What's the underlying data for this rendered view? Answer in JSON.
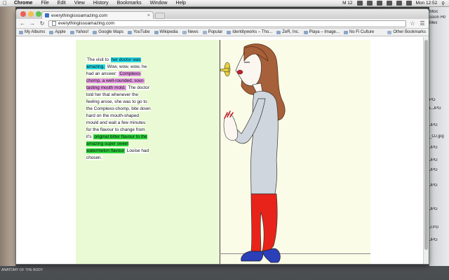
{
  "menubar": {
    "app": "Chrome",
    "items": [
      "File",
      "Edit",
      "View",
      "History",
      "Bookmarks",
      "Window",
      "Help"
    ],
    "status_m": "M 12",
    "clock": "Mon 12:52"
  },
  "browser": {
    "tab_title": "everythingissoamazing.com",
    "url": "everythingissoamazing.com",
    "bookmarks": [
      "My Albums",
      "Apple",
      "Yahoo!",
      "Google Maps",
      "YouTube",
      "Wikipedia",
      "News",
      "Popular",
      "Identityworks – Tho...",
      "ZeR, Inc.",
      "Playa – Image...",
      "No Fi Culture"
    ],
    "other_bookmarks": "Other Bookmarks"
  },
  "desktop": {
    "right_files": [
      "Misc",
      "ssion H0",
      "Mex",
      "PG",
      "L.JPG",
      "JPG",
      "_OJ.jpg",
      "JPG",
      "JPG",
      "JPG",
      "JPG",
      "JPG",
      "J.PG",
      "JPG"
    ],
    "bottom_caption": "ANATOMY OF THE BODY"
  },
  "comic": {
    "story": {
      "p1": "The visit to ",
      "h1": "her doctor was amazing.",
      "p2": " Wow, wow, wow, he had an answer: ",
      "h2": "Complexo-chomp, a well-rounded, sour-tasting mouth mold.",
      "p3": " The doctor told her that whenever the feeling arose, she was to go to the Complexo-chomp, bite down hard on the mouth-shaped mould and wait a few minutes for the flavour to change from it's ",
      "h3": "original bitter flavour to the amazing super sweet watermelon flavour",
      "p4": " Louise had chosen."
    }
  },
  "colors": {
    "highlight_cyan": "#21d6e6",
    "highlight_pink": "#e79ae6",
    "highlight_green": "#2ad33a",
    "panel_left_bg": "#eafad5",
    "panel_right_bg": "#fbfce8"
  }
}
